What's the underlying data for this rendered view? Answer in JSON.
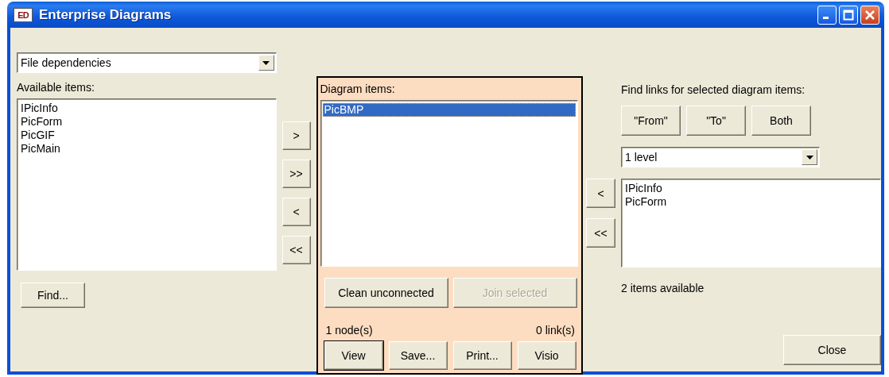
{
  "window": {
    "icon_text": "ED",
    "title": "Enterprise Diagrams"
  },
  "left": {
    "diagram_type": "File dependencies",
    "available_label": "Available items:",
    "available_items": [
      {
        "label": "IPicInfo",
        "selected": false
      },
      {
        "label": "PicForm",
        "selected": false
      },
      {
        "label": "PicGIF",
        "selected": false
      },
      {
        "label": "PicMain",
        "selected": false
      }
    ],
    "find_button": "Find..."
  },
  "transfer_buttons": [
    ">",
    ">>",
    "<",
    "<<"
  ],
  "diagram": {
    "label": "Diagram items:",
    "items": [
      {
        "label": "PicBMP",
        "selected": true
      }
    ],
    "clean_button": {
      "label": "Clean unconnected",
      "disabled": false
    },
    "join_button": {
      "label": "Join selected",
      "disabled": true
    },
    "node_count": "1 node(s)",
    "link_count": "0 link(s)",
    "actions": [
      {
        "label": "View",
        "default": true
      },
      {
        "label": "Save...",
        "default": false
      },
      {
        "label": "Print...",
        "default": false
      },
      {
        "label": "Visio",
        "default": false
      }
    ]
  },
  "links": {
    "label": "Find links for selected diagram items:",
    "direction_buttons": [
      "\"From\"",
      "\"To\"",
      "Both"
    ],
    "depth": "1 level",
    "transfer_buttons": [
      "<",
      "<<"
    ],
    "items": [
      {
        "label": "IPicInfo",
        "selected": false
      },
      {
        "label": "PicForm",
        "selected": false
      }
    ],
    "status": "2 items available"
  },
  "close_button": "Close"
}
